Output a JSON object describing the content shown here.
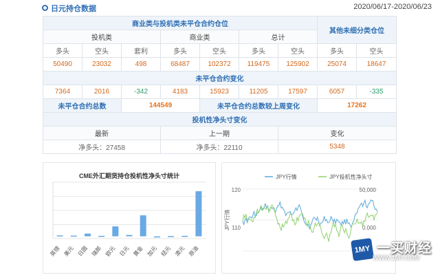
{
  "header": {
    "title": "日元持仓数据",
    "date_range": "2020/06/17-2020/06/23"
  },
  "table": {
    "group_commercial_spec": "商业类与投机类未平仓合约仓位",
    "group_other": "其他未细分类仓位",
    "cat_spec": "投机类",
    "cat_commercial": "商业类",
    "cat_total": "总计",
    "col_long": "多头",
    "col_short": "空头",
    "col_spread": "套利",
    "values": [
      "50490",
      "23032",
      "498",
      "68487",
      "102372",
      "119475",
      "125902",
      "25074",
      "18647"
    ],
    "oi_change_title": "未平仓合约变化",
    "changes": [
      "7364",
      "2016",
      "-342",
      "4183",
      "15923",
      "11205",
      "17597",
      "6057",
      "-335"
    ],
    "oi_total_label": "未平仓合约总数",
    "oi_total_value": "144549",
    "oi_week_change_label": "未平仓合约总数较上周变化",
    "oi_week_change_value": "17262",
    "net_spec_title": "投机性净头寸变化",
    "latest_label": "最新",
    "prev_label": "上一期",
    "change_label": "变化",
    "latest_value": "净多头：27458",
    "prev_value": "净多头：22110",
    "change_value": "5348"
  },
  "chart_data": [
    {
      "type": "bar",
      "title": "CME外汇期货持仓投机性净头寸统计",
      "categories": [
        "英镑",
        "美元",
        "日圆",
        "瑞郎",
        "欧元",
        "日元",
        "黄金",
        "加元",
        "纽元",
        "澳元",
        "原油"
      ],
      "values": [
        0.4,
        0.3,
        1.2,
        0.2,
        4.4,
        0.6,
        9.3,
        -0.5,
        0.1,
        0.2,
        20.0
      ],
      "ylim": [
        -1,
        24
      ],
      "grid": true,
      "color": "#6aaae4"
    },
    {
      "type": "line",
      "series": [
        {
          "name": "JPY行情",
          "color": "#5aa6dc"
        },
        {
          "name": "JPY投机性净头寸",
          "color": "#8fd16b"
        }
      ],
      "y_ticks_left": [
        "120",
        "110"
      ],
      "y_ticks_right": [
        "50,000",
        "0.000"
      ],
      "ylabel": "JPY行情"
    }
  ],
  "logo": {
    "badge": "1MY",
    "name": "一买财经",
    "url": "WWW.1MY.COM"
  }
}
